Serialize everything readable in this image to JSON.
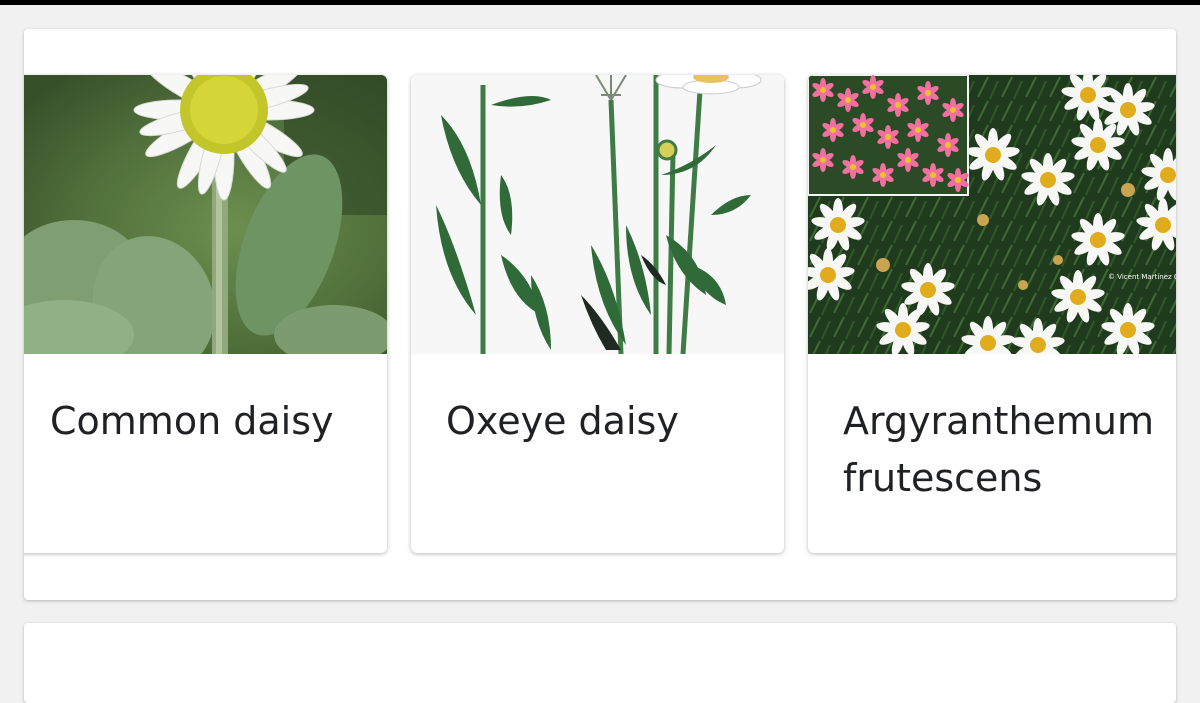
{
  "results": {
    "cards": [
      {
        "label": "Common daisy",
        "image": "common-daisy-photo"
      },
      {
        "label": "Oxeye daisy",
        "image": "oxeye-daisy-illustration"
      },
      {
        "label": "Argyranthemum frutescens",
        "image": "argyranthemum-photo",
        "watermark": "© Vicent Martínez C"
      }
    ]
  }
}
